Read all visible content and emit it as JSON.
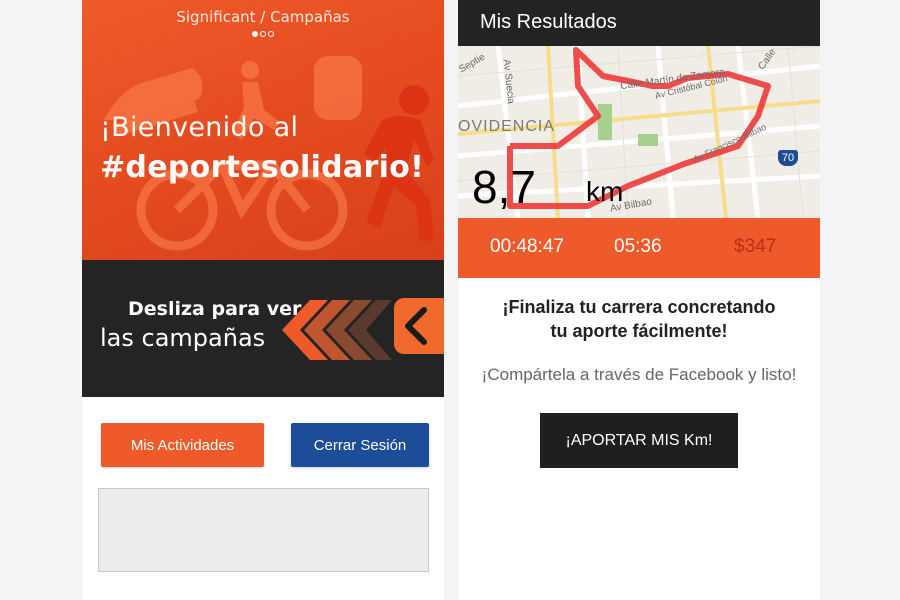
{
  "left_screen": {
    "header_title": "Significant / Campañas",
    "carousel_dots": [
      true,
      false,
      false
    ],
    "welcome_line1": "¡Bienvenido al",
    "welcome_line2": "#deportesolidario!",
    "swipe_line1": "Desliza para ver",
    "swipe_line2": "las campañas",
    "activities_button": "Mis Actividades",
    "logout_button": "Cerrar Sesión",
    "colors": {
      "accent": "#ee5a2a",
      "dark": "#242424",
      "blue": "#1d4d99"
    }
  },
  "right_screen": {
    "header_title": "Mis Resultados",
    "map": {
      "labels": {
        "neighborhood": "OVIDENCIA",
        "street_1": "Calle Martín de Zamora",
        "street_2": "Av Suecia",
        "street_3": "Septie",
        "street_4": "Av Bilbao",
        "street_5": "Calle",
        "street_6": "Av Cristóbal Colón",
        "street_7": "Av Francisco Bilbao",
        "highway_shield": "70"
      },
      "distance_value": "8,7",
      "distance_unit": "km"
    },
    "stats": {
      "time": "00:48:47",
      "pace": "05:36",
      "amount": "$347"
    },
    "message_line1": "¡Finaliza tu carrera concretando",
    "message_line2": "tu aporte fácilmente!",
    "share_text": "¡Compártela a través de Facebook y listo!",
    "contribute_button": "¡APORTAR MIS Km!"
  }
}
